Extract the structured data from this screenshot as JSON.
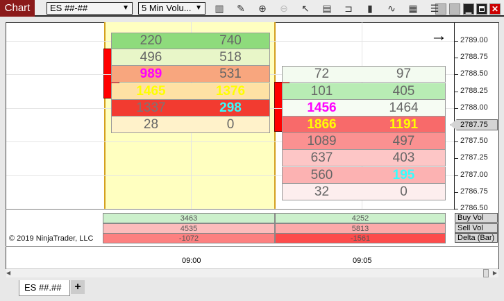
{
  "window": {
    "title": "Chart",
    "instrument": "ES ##-##",
    "interval": "5 Min Volu..."
  },
  "toolbar_icons": [
    "bar-type-icon",
    "pencil-icon",
    "zoom-in-icon",
    "zoom-out-icon",
    "pointer-icon",
    "data-box-icon",
    "properties-icon",
    "indicators-icon",
    "strategies-icon",
    "templates-icon",
    "list-icon"
  ],
  "price_axis": {
    "labels": [
      "2789.00",
      "2788.75",
      "2788.50",
      "2788.25",
      "2788.00",
      "2787.75",
      "2787.50",
      "2787.25",
      "2787.00",
      "2786.75",
      "2786.50"
    ],
    "current": "2787.75"
  },
  "bar1": {
    "rows": [
      {
        "bid": "220",
        "ask": "740",
        "bg": "#8edb7c",
        "bidc": "#666",
        "askc": "#666"
      },
      {
        "bid": "496",
        "ask": "518",
        "bg": "#e8f6c8",
        "bidc": "#666",
        "askc": "#666"
      },
      {
        "bid": "989",
        "ask": "531",
        "bg": "#f8a67e",
        "bidc": "#ff00ff",
        "askc": "#666"
      },
      {
        "bid": "1465",
        "ask": "1376",
        "bg": "#fee1a4",
        "bidc": "#ffff00",
        "askc": "#ffff00"
      },
      {
        "bid": "1337",
        "ask": "298",
        "bg": "#f23b30",
        "bidc": "#777",
        "askc": "#33ffff"
      },
      {
        "bid": "28",
        "ask": "0",
        "bg": "#fff2ca",
        "bidc": "#666",
        "askc": "#666"
      }
    ]
  },
  "bar2": {
    "rows": [
      {
        "bid": "72",
        "ask": "97",
        "bg": "#f3fbf0",
        "bidc": "#666",
        "askc": "#666"
      },
      {
        "bid": "101",
        "ask": "405",
        "bg": "#b8ecb4",
        "bidc": "#666",
        "askc": "#666"
      },
      {
        "bid": "1456",
        "ask": "1464",
        "bg": "#f6fcf3",
        "bidc": "#ff00ff",
        "askc": "#666"
      },
      {
        "bid": "1866",
        "ask": "1191",
        "bg": "#f86a6a",
        "bidc": "#ffff00",
        "askc": "#ffff00"
      },
      {
        "bid": "1089",
        "ask": "497",
        "bg": "#fb9191",
        "bidc": "#666",
        "askc": "#666"
      },
      {
        "bid": "637",
        "ask": "403",
        "bg": "#fdc6c6",
        "bidc": "#666",
        "askc": "#666"
      },
      {
        "bid": "560",
        "ask": "195",
        "bg": "#fcb2b2",
        "bidc": "#666",
        "askc": "#33ffff"
      },
      {
        "bid": "32",
        "ask": "0",
        "bg": "#fdeeee",
        "bidc": "#666",
        "askc": "#666"
      }
    ]
  },
  "summary": {
    "labels": [
      "Buy Vol",
      "Sell Vol",
      "Delta (Bar)"
    ],
    "rows": [
      {
        "values": [
          "3463",
          "4252"
        ],
        "bgs": [
          "#ccf0cc",
          "#ccf0cc"
        ]
      },
      {
        "values": [
          "4535",
          "5813"
        ],
        "bgs": [
          "#fdbcbc",
          "#fdaaaa"
        ]
      },
      {
        "values": [
          "-1072",
          "-1561"
        ],
        "bgs": [
          "#fd8080",
          "#fd4c4c"
        ]
      }
    ]
  },
  "time_axis": [
    "09:00",
    "09:05"
  ],
  "copyright": "© 2019 NinjaTrader, LLC",
  "bottom_tabs": {
    "active": "ES ##.##",
    "add": "+"
  }
}
